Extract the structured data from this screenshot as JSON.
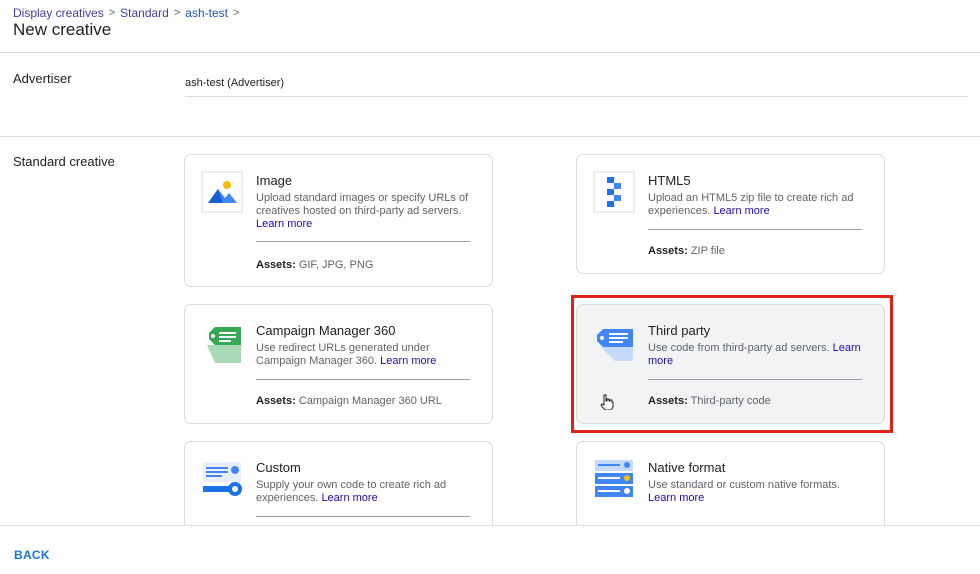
{
  "breadcrumb": {
    "items": [
      "Display creatives",
      "Standard",
      "ash-test"
    ],
    "separator": ">"
  },
  "page_title": "New creative",
  "advertiser": {
    "label": "Advertiser",
    "value": "ash-test (Advertiser)"
  },
  "standard_creative": {
    "label": "Standard creative",
    "cards": [
      {
        "title": "Image",
        "description": "Upload standard images or specify URLs of creatives hosted on third-party ad servers.",
        "learn_more": "Learn more",
        "assets_label": "Assets:",
        "assets_value": "GIF, JPG, PNG",
        "icon": "image-icon"
      },
      {
        "title": "HTML5",
        "description": "Upload an HTML5 zip file to create rich ad experiences.",
        "learn_more": "Learn more",
        "assets_label": "Assets:",
        "assets_value": "ZIP file",
        "icon": "html5-icon"
      },
      {
        "title": "Campaign Manager 360",
        "description": "Use redirect URLs generated under Campaign Manager 360.",
        "learn_more": "Learn more",
        "assets_label": "Assets:",
        "assets_value": "Campaign Manager 360 URL",
        "icon": "campaign-manager-tag-icon"
      },
      {
        "title": "Third party",
        "description": "Use code from third-party ad servers.",
        "learn_more": "Learn more",
        "assets_label": "Assets:",
        "assets_value": "Third-party code",
        "icon": "third-party-tag-icon",
        "selected": true
      },
      {
        "title": "Custom",
        "description": "Supply your own code to create rich ad experiences.",
        "learn_more": "Learn more",
        "icon": "custom-code-icon"
      },
      {
        "title": "Native format",
        "description": "Use standard or custom native formats.",
        "learn_more": "Learn more",
        "icon": "native-format-icon"
      }
    ]
  },
  "footer": {
    "back_label": "BACK"
  },
  "colors": {
    "accent": "#1a73e8",
    "link": "#1a0dab",
    "highlight": "#e0211a",
    "campaign_manager_green": "#34a853"
  }
}
